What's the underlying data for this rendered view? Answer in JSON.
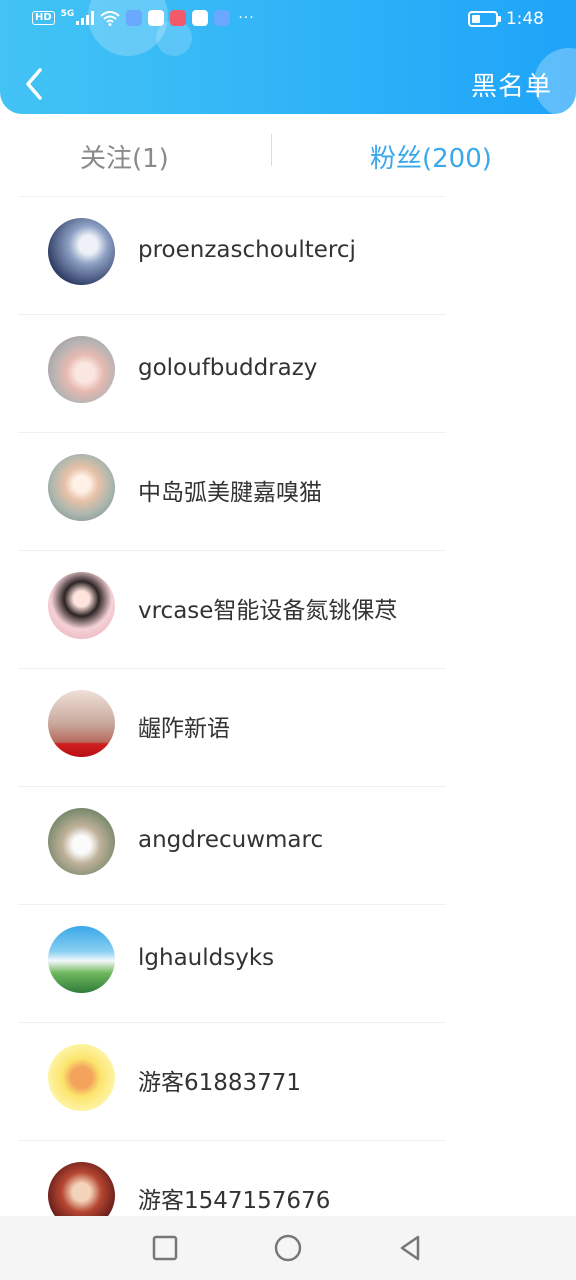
{
  "status_bar": {
    "network_badge": "HD",
    "signal_gen": "5G",
    "time": "1:48",
    "battery_level": 0.35,
    "more_indicator": "···"
  },
  "header": {
    "back_icon": "chevron-left-icon",
    "blacklist_label": "黑名单",
    "gradient_start": "#43c3f4",
    "gradient_end": "#1fa3f8"
  },
  "tabs": {
    "follow_label": "关注(1)",
    "fans_label": "粉丝(200)",
    "active_color": "#3aa8ea",
    "inactive_color": "#8a8a8a"
  },
  "users": [
    {
      "name": "proenzaschoultercj"
    },
    {
      "name": "goloufbuddrazy"
    },
    {
      "name": "中岛弧美腱嘉嗅猫"
    },
    {
      "name": "vrcase智能设备氮铫倮荩"
    },
    {
      "name": "龌阼新语"
    },
    {
      "name": "angdrecuwmarc"
    },
    {
      "name": "lghauldsyks"
    },
    {
      "name": "游客61883771"
    },
    {
      "name": "游客1547157676"
    }
  ],
  "navbar": {
    "recent_icon": "square-icon",
    "home_icon": "circle-icon",
    "back_icon": "triangle-back-icon"
  }
}
